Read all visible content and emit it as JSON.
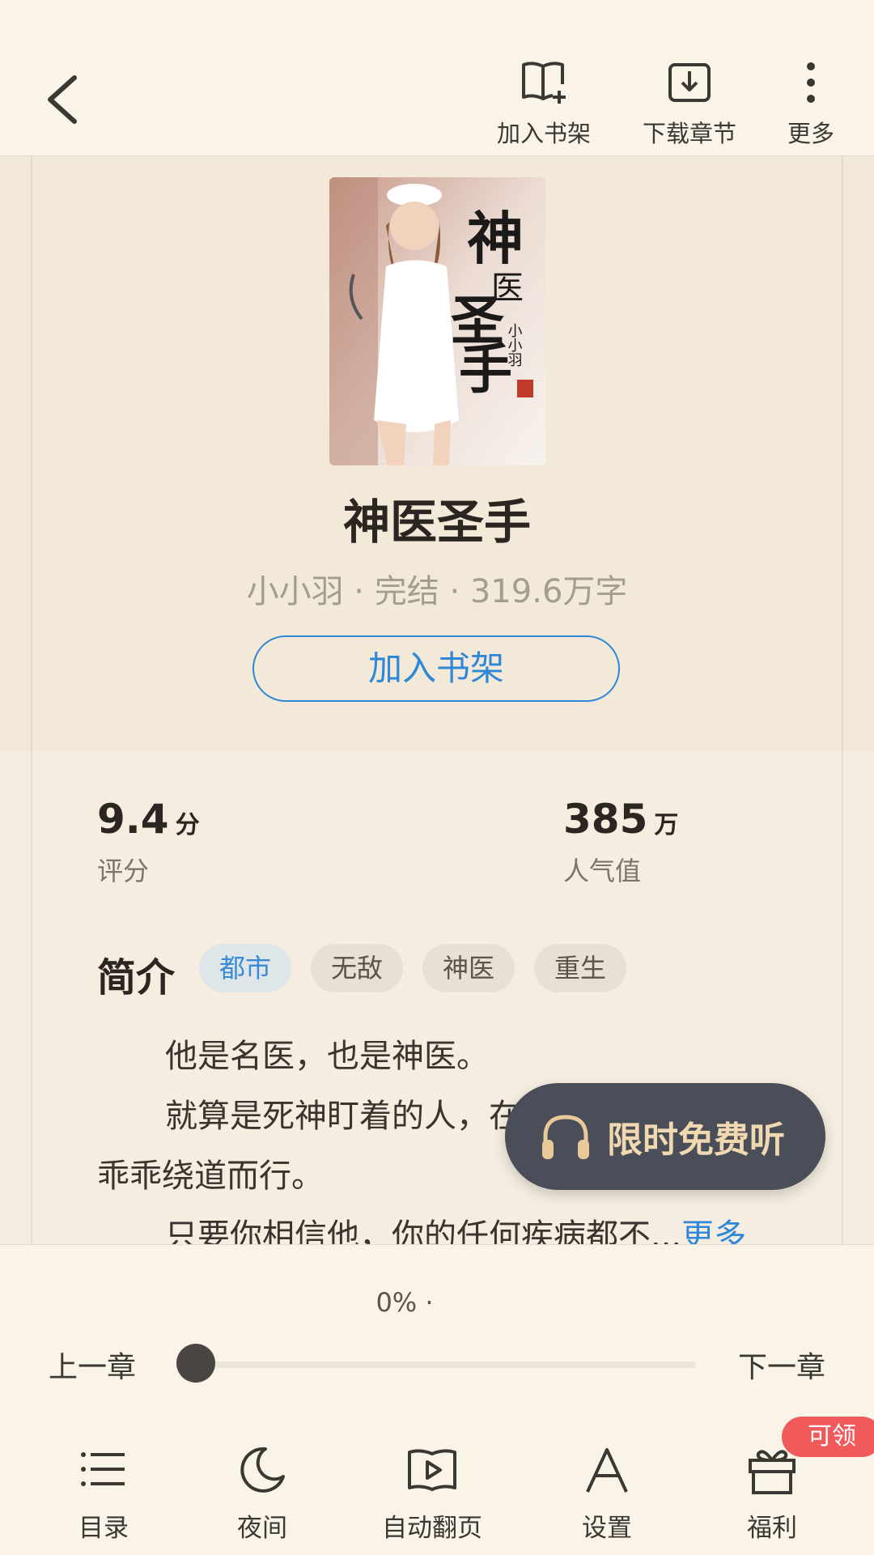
{
  "toolbar": {
    "add_shelf": "加入书架",
    "download": "下载章节",
    "more": "更多"
  },
  "book": {
    "title": "神医圣手",
    "meta": "小小羽 · 完结 · 319.6万字",
    "add_shelf_button": "加入书架",
    "cover_text": "神医圣手",
    "cover_author": "小小羽"
  },
  "stats": {
    "rating_value": "9.4",
    "rating_unit": "分",
    "rating_label": "评分",
    "popularity_value": "385",
    "popularity_unit": "万",
    "popularity_label": "人气值"
  },
  "intro": {
    "heading": "简介",
    "tags": [
      "都市",
      "无敌",
      "神医",
      "重生"
    ],
    "lines": [
      "他是名医，也是神医。",
      "就算是死神盯着的人，在",
      "乖乖绕道而行。",
      "只要你相信他，你的任何疾病都不..."
    ],
    "more_link": "更多"
  },
  "listen_button": "限时免费听",
  "progress": {
    "percent_text": "0% ·",
    "value": 0,
    "prev_chapter": "上一章",
    "next_chapter": "下一章"
  },
  "bottom_nav": {
    "items": [
      "目录",
      "夜间",
      "自动翻页",
      "设置",
      "福利"
    ],
    "badge": "可领"
  },
  "colors": {
    "accent": "#2f87d8",
    "background": "#f5ede0",
    "listen_bg": "#4a4e58",
    "badge": "#f05a5a"
  }
}
